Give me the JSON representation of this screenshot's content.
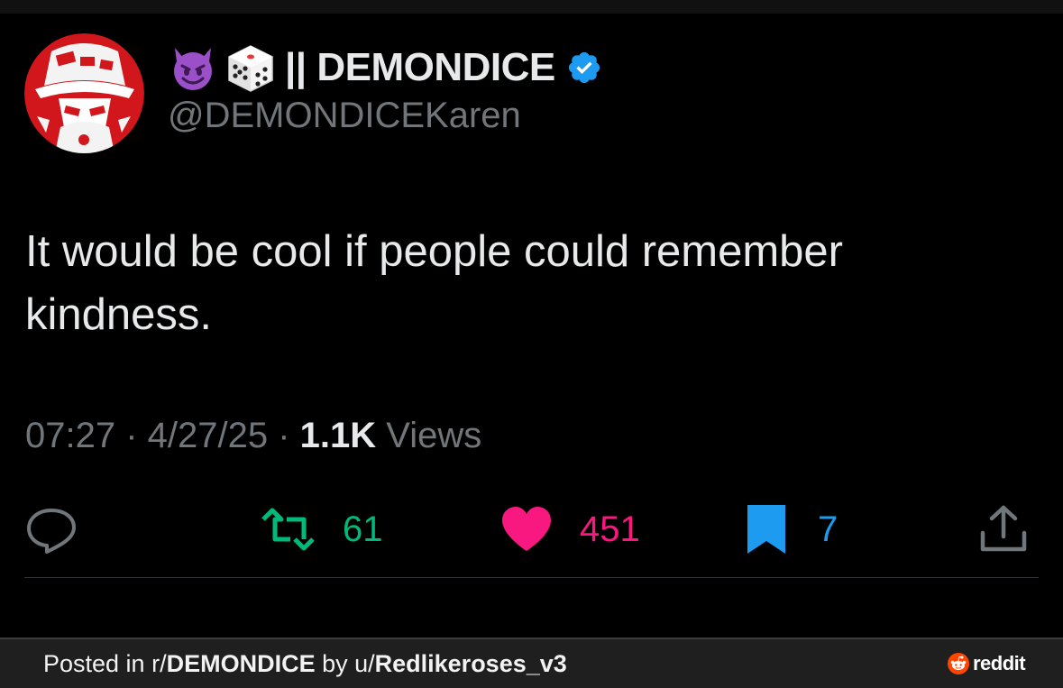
{
  "tweet": {
    "display_name": "|| DEMONDICE",
    "name_emojis": [
      "smiling-imp-emoji",
      "game-die-emoji"
    ],
    "verified": true,
    "handle": "@DEMONDICEKaren",
    "text": "It would be cool if people could remember kindness.",
    "time": "07:27",
    "date": "4/27/25",
    "views_count": "1.1K",
    "views_label": "Views",
    "separator": " · "
  },
  "actions": {
    "reply": {
      "icon": "reply-icon",
      "count": ""
    },
    "retweet": {
      "icon": "retweet-icon",
      "count": "61",
      "color": "#00ba7c"
    },
    "like": {
      "icon": "heart-icon",
      "count": "451",
      "color": "#f91880"
    },
    "bookmark": {
      "icon": "bookmark-icon",
      "count": "7",
      "color": "#1d9bf0"
    },
    "share": {
      "icon": "share-icon"
    }
  },
  "footer": {
    "posted_in_prefix": "Posted in r/",
    "subreddit": "DEMONDICE",
    "by_prefix": " by u/",
    "username": "Redlikeroses_v3",
    "brand": "reddit"
  },
  "colors": {
    "background": "#000000",
    "text_primary": "#e7e9ea",
    "text_secondary": "#71767b",
    "verified_blue": "#1d9bf0",
    "avatar_red": "#d1161c"
  }
}
